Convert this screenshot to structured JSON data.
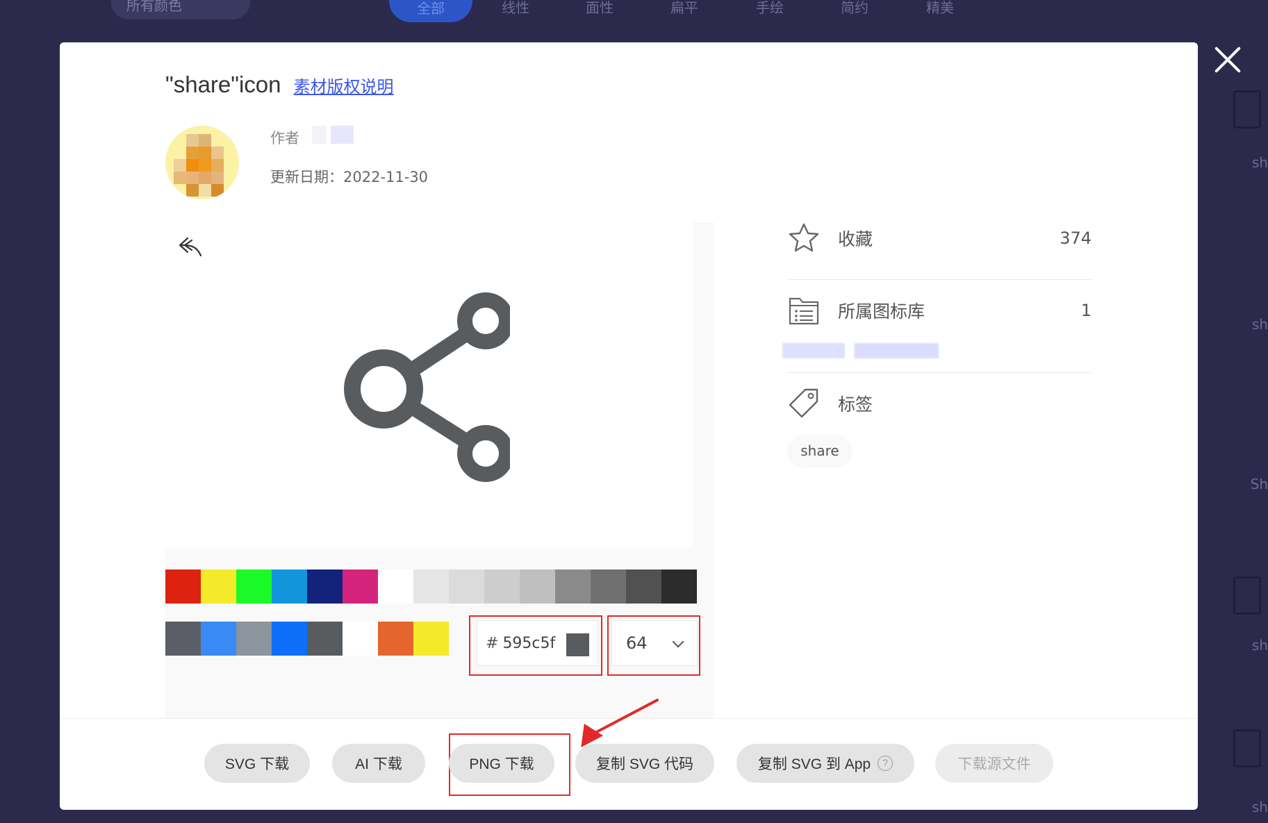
{
  "background": {
    "filters": [
      "所有颜色"
    ],
    "tabs": [
      {
        "label": "全部",
        "active": true
      },
      {
        "label": "线性"
      },
      {
        "label": "面性"
      },
      {
        "label": "扁平"
      },
      {
        "label": "手绘"
      },
      {
        "label": "简约"
      },
      {
        "label": "精美"
      }
    ],
    "side_labels": [
      "sh",
      "sh",
      "Sh",
      "sh",
      "sh"
    ]
  },
  "modal": {
    "title": "\"share\"icon",
    "copyright_link": "素材版权说明",
    "author_label": "作者",
    "update_date": "更新日期：2022-11-30",
    "close_icon": "close-icon",
    "preview": {
      "undo_icon": "undo-icon",
      "icon_name": "share-icon",
      "icon_color": "#595c5f"
    },
    "palette_row1": [
      "#dd2211",
      "#f4ea2a",
      "#1afa29",
      "#1296db",
      "#13227a",
      "#d4237a",
      "#ffffff",
      "#e6e6e6",
      "#dbdbdb",
      "#cdcdcd",
      "#bfbfbf",
      "#8a8a8a",
      "#707070",
      "#515151",
      "#2c2c2c"
    ],
    "palette_row2": [
      "#5b5e66",
      "#3a89f5",
      "#8c949e",
      "#0d6ff7",
      "#595c5f",
      "#ffffff",
      "#e5652e",
      "#f4ea2a"
    ],
    "color_input": {
      "hash": "#",
      "value": "595c5f"
    },
    "size_select": {
      "value": "64"
    },
    "info": {
      "favorite": {
        "label": "收藏",
        "count": "374",
        "icon": "star-icon"
      },
      "library": {
        "label": "所属图标库",
        "count": "1",
        "icon": "folder-list-icon"
      },
      "tags": {
        "label": "标签",
        "icon": "tag-icon",
        "items": [
          "share"
        ]
      }
    },
    "actions": {
      "svg_download": "SVG 下载",
      "ai_download": "AI 下载",
      "png_download": "PNG 下载",
      "copy_svg_code": "复制 SVG 代码",
      "copy_svg_app": "复制 SVG 到 App",
      "help": "?",
      "download_source": "下载源文件"
    },
    "annotation_color": "#e02a2a"
  }
}
